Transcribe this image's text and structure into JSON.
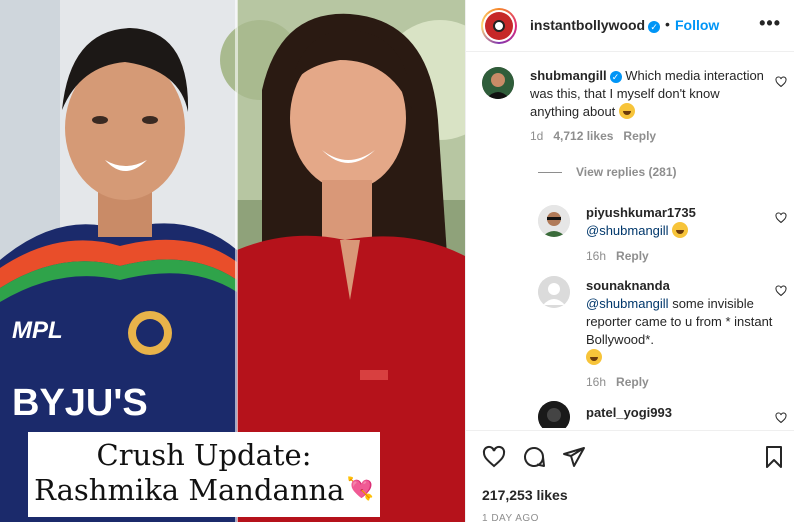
{
  "post": {
    "account": "instantbollywood",
    "follow_label": "Follow",
    "separator": "•",
    "more_label": "•••",
    "verified_mark": "✓",
    "caption_line1": "Crush Update:",
    "caption_line2": "Rashmika Mandanna",
    "caption_emoji": "💘",
    "likes": "217,253 likes",
    "time": "1 DAY AGO"
  },
  "comments": [
    {
      "user": "shubmangill",
      "verified": true,
      "text": "Which media interaction was this, that I myself don't know anything about",
      "emoji": "thinking-face",
      "age": "1d",
      "likes": "4,712 likes",
      "reply_label": "Reply"
    }
  ],
  "view_replies": "View replies (281)",
  "replies": [
    {
      "user": "piyushkumar1735",
      "mention": "@shubmangill",
      "text": "",
      "emoji": "grinning-squinting-face",
      "age": "16h",
      "reply_label": "Reply"
    },
    {
      "user": "sounaknanda",
      "mention": "@shubmangill",
      "text": "some invisible reporter came to u from * instant Bollywood*.",
      "emoji": "grinning-squinting-face",
      "age": "16h",
      "reply_label": "Reply"
    },
    {
      "user": "patel_yogi993"
    }
  ],
  "icons": [
    "heart-icon",
    "comment-icon",
    "share-icon",
    "bookmark-icon",
    "verified-icon",
    "more-icon"
  ],
  "colors": {
    "link": "#0095f6",
    "mention": "#00376b",
    "muted": "#8e8e8e",
    "text": "#262626",
    "jersey": "#1b2a6b",
    "dress": "#b5121b"
  }
}
